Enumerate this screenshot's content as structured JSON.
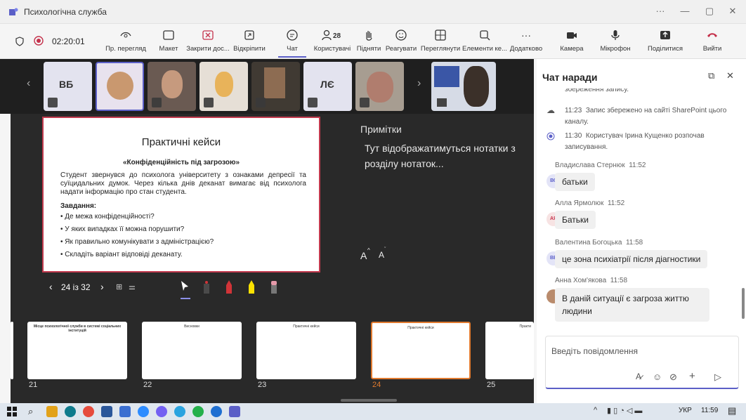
{
  "window": {
    "title": "Психологічна служба",
    "min": "—",
    "max": "▢",
    "close": "✕",
    "more": "···"
  },
  "toolbar": {
    "timer": "02:20:01",
    "items": [
      {
        "label": "Пр. перегляд"
      },
      {
        "label": "Макет"
      },
      {
        "label": "Закрити дос..."
      },
      {
        "label": "Відкріпити"
      },
      {
        "label": "Чат"
      },
      {
        "label": "Користувачі"
      },
      {
        "label": "Підняти"
      },
      {
        "label": "Реагувати"
      },
      {
        "label": "Переглянути"
      },
      {
        "label": "Елементи ке..."
      },
      {
        "label": "Додатково"
      },
      {
        "label": "Камера"
      },
      {
        "label": "Мікрофон"
      },
      {
        "label": "Поділитися"
      },
      {
        "label": "Вийти"
      }
    ],
    "participants_count": "28"
  },
  "participants": [
    {
      "initials": "ВБ"
    },
    {
      "initials": "ЛЄ"
    }
  ],
  "slide": {
    "title": "Практичні кейси",
    "subtitle": "«Конфіденційність під загрозою»",
    "body": "Студент звернувся до психолога університету з ознаками депресії та суїцидальних думок. Через кілька днів деканат вимагає від психолога надати інформацію про стан студента.",
    "tasks_title": "Завдання:",
    "tasks": [
      "• Де межа конфіденційності?",
      "• У яких випадках її можна порушити?",
      "• Як правильно комунікувати з адміністрацією?",
      "• Складіть варіант відповіді деканату."
    ]
  },
  "notes": {
    "title": "Примітки",
    "text": "Тут відображатимуться нотатки з розділу нотаток..."
  },
  "navigation": {
    "page": "24 із 32",
    "font_up": "A",
    "font_down": "A"
  },
  "thumbnails": [
    {
      "num": "21",
      "title": "Місце психологічної служби в системі соціальних інституцій"
    },
    {
      "num": "22",
      "title": "Висновки"
    },
    {
      "num": "23",
      "title": "Практичні кейси"
    },
    {
      "num": "24",
      "title": "Практичні кейси"
    },
    {
      "num": "25",
      "title": "Практи"
    }
  ],
  "chat": {
    "title": "Чат наради",
    "top_partial": "збереження запису.",
    "events": [
      {
        "time": "11:23",
        "text": "Запис збережено на сайті SharePoint цього каналу."
      },
      {
        "time": "11:30",
        "text": "Користувач Ірина Кущенко розпочав записування."
      }
    ],
    "messages": [
      {
        "author": "Владислава Стернюк",
        "time": "11:52",
        "initials": "ВС",
        "text": "батьки"
      },
      {
        "author": "Алла Ярмолюк",
        "time": "11:52",
        "initials": "АЯ",
        "text": "Батьки"
      },
      {
        "author": "Валентина Богоцька",
        "time": "11:58",
        "initials": "ВБ",
        "text": "це зона психіатрії після діагностики"
      },
      {
        "author": "Анна Хом'якова",
        "time": "11:58",
        "initials": "",
        "text": "В даній ситуації є загроза життю людини"
      }
    ],
    "input_placeholder": "Введіть повідомлення"
  },
  "taskbar": {
    "lang": "УКР",
    "time": "11:59"
  }
}
